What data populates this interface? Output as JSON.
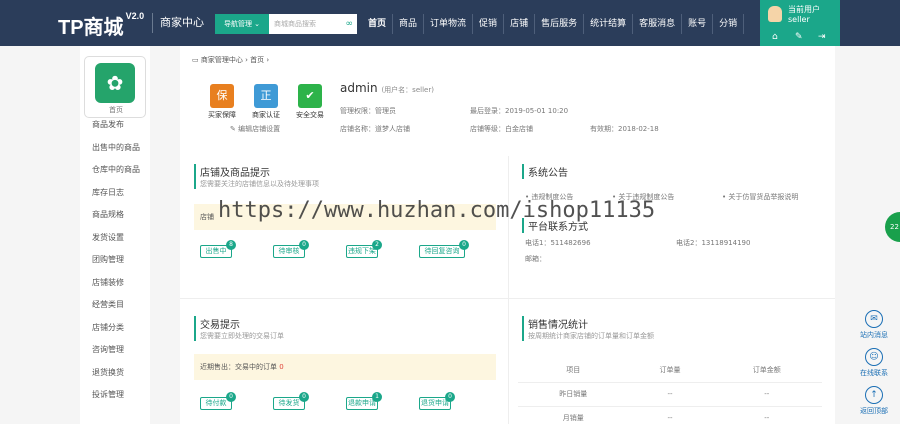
{
  "header": {
    "logo": "TP商城",
    "version": "V2.0",
    "center": "商家中心",
    "nav_manage": "导航管理",
    "search_placeholder": "商城商品搜索",
    "menu": [
      "首页",
      "商品",
      "订单物流",
      "促销",
      "店铺",
      "售后服务",
      "统计结算",
      "客服消息",
      "账号",
      "分销"
    ],
    "user_label": "当前用户",
    "user_name": "seller"
  },
  "sidebar": {
    "logo_label": "首页",
    "items": [
      "商品发布",
      "出售中的商品",
      "仓库中的商品",
      "库存日志",
      "商品规格",
      "发货设置",
      "团购管理",
      "店铺装修",
      "经营类目",
      "店铺分类",
      "咨询管理",
      "退货换货",
      "投诉管理"
    ]
  },
  "breadcrumb": {
    "a": "商家管理中心",
    "b": "首页"
  },
  "profile": {
    "icons": [
      "买家保障",
      "商家认证",
      "安全交易"
    ],
    "edit": "编辑店铺设置",
    "admin": "admin",
    "username_note": "(用户名：seller)",
    "perm_label": "管理权限：管理员",
    "last_login": "最后登录：2019-05-01 10:20",
    "store_name": "店铺名称：道梦人店铺",
    "store_level": "店铺等级：白金店铺",
    "valid": "有效期：2018-02-18"
  },
  "store_tips": {
    "title": "店铺及商品提示",
    "sub": "您需要关注的店铺信息以及待处理事项",
    "notice": "店铺",
    "buttons": [
      {
        "label": "出售中",
        "count": "8"
      },
      {
        "label": "待审核",
        "count": "0"
      },
      {
        "label": "违规下架",
        "count": "2"
      },
      {
        "label": "待回复咨询",
        "count": "0"
      }
    ]
  },
  "announce": {
    "title": "系统公告",
    "items": [
      "违规制度公告",
      "关于违规制度公告",
      "关于仿冒货品举报说明"
    ],
    "contact_title": "平台联系方式",
    "phone1": "电话1：511482696",
    "phone2": "电话2：13118914190",
    "email": "邮箱："
  },
  "trade": {
    "title": "交易提示",
    "sub": "您需要立即处理的交易订单",
    "notice_prefix": "近期售出：交易中的订单",
    "notice_count": "0",
    "buttons": [
      {
        "label": "待付款",
        "count": "0"
      },
      {
        "label": "待发货",
        "count": "0"
      },
      {
        "label": "退款申请",
        "count": "1"
      },
      {
        "label": "退货申请",
        "count": "0"
      }
    ]
  },
  "sales": {
    "title": "销售情况统计",
    "sub": "按周期统计商家店铺的订单量和订单金额",
    "cols": [
      "项目",
      "订单量",
      "订单金额"
    ],
    "rows": [
      [
        "昨日销量",
        "--",
        "--"
      ],
      [
        "月销量",
        "--",
        "--"
      ]
    ]
  },
  "watermark": "https://www.huzhan.com/ishop11135",
  "right": {
    "w1": "站内消息",
    "w1b": "2",
    "w2": "在线联系",
    "w3": "返回顶部",
    "ball": "22"
  }
}
